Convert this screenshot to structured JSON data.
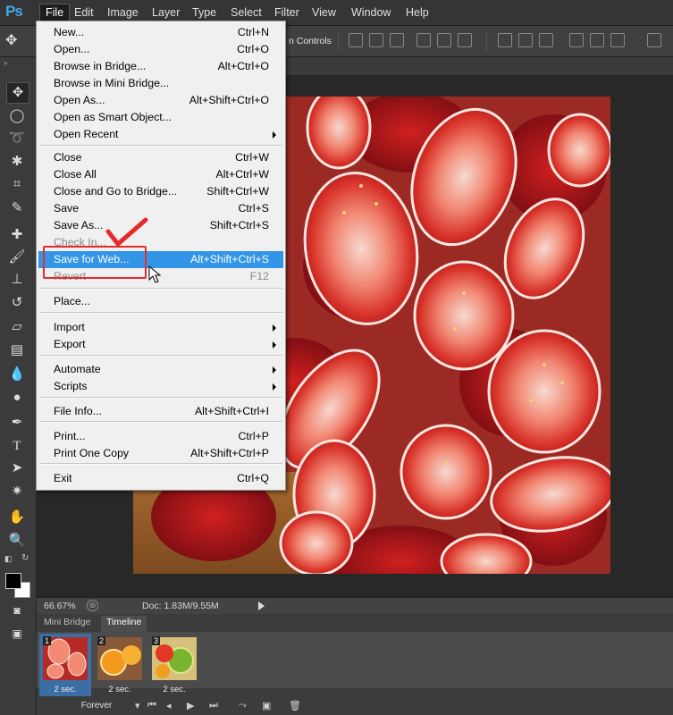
{
  "app": {
    "logo": "Ps"
  },
  "menubar": [
    "File",
    "Edit",
    "Image",
    "Layer",
    "Type",
    "Select",
    "Filter",
    "View",
    "Window",
    "Help"
  ],
  "options_bar": {
    "text": "n Controls"
  },
  "file_menu": {
    "groups": [
      [
        {
          "label": "New...",
          "shortcut": "Ctrl+N"
        },
        {
          "label": "Open...",
          "shortcut": "Ctrl+O"
        },
        {
          "label": "Browse in Bridge...",
          "shortcut": "Alt+Ctrl+O"
        },
        {
          "label": "Browse in Mini Bridge...",
          "shortcut": ""
        },
        {
          "label": "Open As...",
          "shortcut": "Alt+Shift+Ctrl+O"
        },
        {
          "label": "Open as Smart Object...",
          "shortcut": ""
        },
        {
          "label": "Open Recent",
          "shortcut": "",
          "submenu": true
        }
      ],
      [
        {
          "label": "Close",
          "shortcut": "Ctrl+W"
        },
        {
          "label": "Close All",
          "shortcut": "Alt+Ctrl+W"
        },
        {
          "label": "Close and Go to Bridge...",
          "shortcut": "Shift+Ctrl+W"
        },
        {
          "label": "Save",
          "shortcut": "Ctrl+S"
        },
        {
          "label": "Save As...",
          "shortcut": "Shift+Ctrl+S"
        },
        {
          "label": "Check In...",
          "shortcut": "",
          "disabled": true
        },
        {
          "label": "Save for Web...",
          "shortcut": "Alt+Shift+Ctrl+S",
          "highlighted": true
        },
        {
          "label": "Revert",
          "shortcut": "F12",
          "disabled": true
        }
      ],
      [
        {
          "label": "Place...",
          "shortcut": ""
        }
      ],
      [
        {
          "label": "Import",
          "shortcut": "",
          "submenu": true
        },
        {
          "label": "Export",
          "shortcut": "",
          "submenu": true
        }
      ],
      [
        {
          "label": "Automate",
          "shortcut": "",
          "submenu": true
        },
        {
          "label": "Scripts",
          "shortcut": "",
          "submenu": true
        }
      ],
      [
        {
          "label": "File Info...",
          "shortcut": "Alt+Shift+Ctrl+I"
        }
      ],
      [
        {
          "label": "Print...",
          "shortcut": "Ctrl+P"
        },
        {
          "label": "Print One Copy",
          "shortcut": "Alt+Shift+Ctrl+P"
        }
      ],
      [
        {
          "label": "Exit",
          "shortcut": "Ctrl+Q"
        }
      ]
    ]
  },
  "status": {
    "zoom": "66.67%",
    "doc": "Doc: 1.83M/9.55M"
  },
  "timeline": {
    "tabs": [
      "Mini Bridge",
      "Timeline"
    ],
    "frames": [
      {
        "number": "1",
        "delay": "2 sec.",
        "thumb": "strawberry"
      },
      {
        "number": "2",
        "delay": "2 sec.",
        "thumb": "orange"
      },
      {
        "number": "3",
        "delay": "2 sec.",
        "thumb": "kiwi"
      }
    ],
    "loop": "Forever"
  },
  "colors": {
    "menu_highlight": "#3395e8",
    "annotation": "#e52b2b",
    "accent": "#44a7e8"
  }
}
